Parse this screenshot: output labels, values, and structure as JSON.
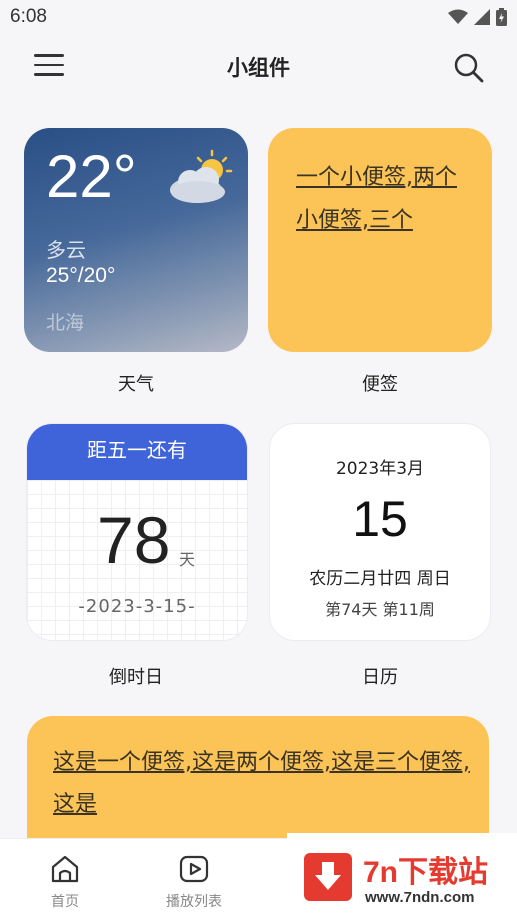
{
  "status": {
    "time": "6:08"
  },
  "appbar": {
    "title": "小组件"
  },
  "widgets": {
    "weather": {
      "temp": "22°",
      "condition": "多云",
      "range": "25°/20°",
      "city": "北海",
      "caption": "天气"
    },
    "note": {
      "text": "一个小便签,两个小便签,三个",
      "caption": "便签"
    },
    "countdown": {
      "header": "距五一还有",
      "days": "78",
      "unit": "天",
      "date": "-2023-3-15-",
      "caption": "倒时日"
    },
    "calendar": {
      "year_month": "2023年3月",
      "day": "15",
      "lunar": "农历二月廿四  周日",
      "week": "第74天 第11周",
      "caption": "日历"
    },
    "note2": {
      "text": "这是一个便签,这是两个便签,这是三个便签,这是"
    }
  },
  "bottom_nav": [
    {
      "label": "首页",
      "icon": "home-icon"
    },
    {
      "label": "播放列表",
      "icon": "play-icon"
    }
  ],
  "watermark": {
    "brand": "7n下载站",
    "url": "www.7ndn.com"
  },
  "colors": {
    "note_yellow": "#fcc456",
    "countdown_blue": "#3f63d8",
    "brand_red": "#e53a2f"
  }
}
